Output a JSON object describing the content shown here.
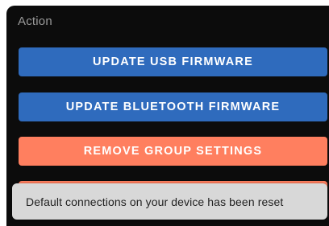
{
  "section": {
    "title": "Action"
  },
  "buttons": {
    "update_usb": "UPDATE USB FIRMWARE",
    "update_bluetooth": "UPDATE BLUETOOTH FIRMWARE",
    "remove_group": "REMOVE GROUP SETTINGS"
  },
  "toast": {
    "message": "Default connections on your device has been reset"
  },
  "colors": {
    "background": "#0c0c0c",
    "primary_button": "#2f6bbd",
    "warning_button": "#ff7f5f",
    "toast_background": "#d8d8d8"
  }
}
